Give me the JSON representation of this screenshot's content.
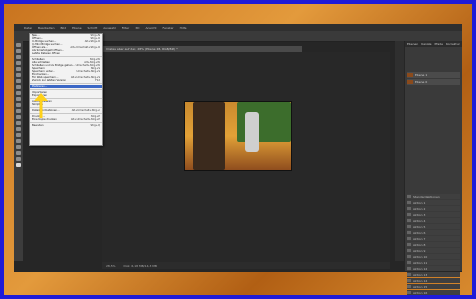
{
  "menubar": {
    "items": [
      "Datei",
      "Bearbeiten",
      "Bild",
      "Ebene",
      "Schrift",
      "Auswahl",
      "Filter",
      "3D",
      "Ansicht",
      "Fenster",
      "Hilfe"
    ]
  },
  "document": {
    "tab_title": "Imstes aber auf der, 28% (Ebene 28, RGB/8#) *"
  },
  "status": {
    "zoom": "28,5%",
    "doc": "Dok: 6,18 MB/14,3 MB"
  },
  "layers": {
    "tabs": [
      "Ebenen",
      "Kanäle",
      "Pfade",
      "Korrektur"
    ],
    "items": [
      {
        "name": "Ebene 1"
      },
      {
        "name": "Ebene 0"
      }
    ]
  },
  "actions": {
    "items": [
      "Standardaktionen",
      "Aktion 1",
      "Aktion 2",
      "Aktion 3",
      "Aktion 4",
      "Aktion 5",
      "Aktion 6",
      "Aktion 7",
      "Aktion 8",
      "Aktion 9",
      "Aktion 10",
      "Aktion 11",
      "Aktion 12",
      "Aktion 13",
      "Aktion 14",
      "Aktion 15",
      "Aktion 16"
    ]
  },
  "menu": {
    "items": [
      {
        "label": "Neu...",
        "shortcut": "Strg+N"
      },
      {
        "label": "Öffnen...",
        "shortcut": "Strg+O"
      },
      {
        "label": "In Bridge suchen...",
        "shortcut": "Alt+Strg+O"
      },
      {
        "label": "In Mini Bridge suchen...",
        "shortcut": ""
      },
      {
        "label": "Öffnen als...",
        "shortcut": "Alt+Umschalt+Strg+O"
      },
      {
        "label": "Als Smartobjekt öffnen...",
        "shortcut": ""
      },
      {
        "label": "Letzte Dateien öffnen",
        "shortcut": ""
      },
      {
        "sep": true
      },
      {
        "label": "Schließen",
        "shortcut": "Strg+W"
      },
      {
        "label": "Alle schließen",
        "shortcut": "Alt+Strg+W"
      },
      {
        "label": "Schließen und zu Bridge gehen...",
        "shortcut": "Umschalt+Strg+W"
      },
      {
        "label": "Speichern",
        "shortcut": "Strg+S"
      },
      {
        "label": "Speichern unter...",
        "shortcut": "Umschalt+Strg+S"
      },
      {
        "label": "Einchecken...",
        "shortcut": ""
      },
      {
        "label": "Für Web speichern...",
        "shortcut": "Alt+Umschalt+Strg+S"
      },
      {
        "label": "Zurück zur letzten Version",
        "shortcut": "F12"
      },
      {
        "sep": true
      },
      {
        "label": "Platzieren...",
        "shortcut": ""
      },
      {
        "sep": true
      },
      {
        "label": "Importieren",
        "shortcut": ""
      },
      {
        "label": "Exportieren",
        "shortcut": ""
      },
      {
        "sep": true
      },
      {
        "label": "Automatisieren",
        "shortcut": ""
      },
      {
        "label": "Skripten",
        "shortcut": ""
      },
      {
        "sep": true
      },
      {
        "label": "Dateiinformationen...",
        "shortcut": "Alt+Umschalt+Strg+I"
      },
      {
        "sep": true
      },
      {
        "label": "Drucken...",
        "shortcut": "Strg+P"
      },
      {
        "label": "Eine Kopie drucken",
        "shortcut": "Alt+Umschalt+Strg+P"
      },
      {
        "sep": true
      },
      {
        "label": "Beenden",
        "shortcut": "Strg+Q"
      }
    ],
    "highlighted_index": 17
  }
}
